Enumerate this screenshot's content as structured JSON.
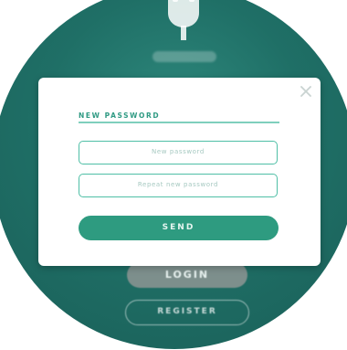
{
  "background": {
    "screen_color": "#1f6f66",
    "plug_icon": "plug-icon"
  },
  "buttons": {
    "login_label": "LOGIN",
    "register_label": "REGISTER"
  },
  "modal": {
    "title": "NEW PASSWORD",
    "close_icon": "close-icon",
    "new_password_placeholder": "New password",
    "repeat_password_placeholder": "Repeat new password",
    "send_label": "SEND",
    "accent_color": "#2e9b80"
  }
}
